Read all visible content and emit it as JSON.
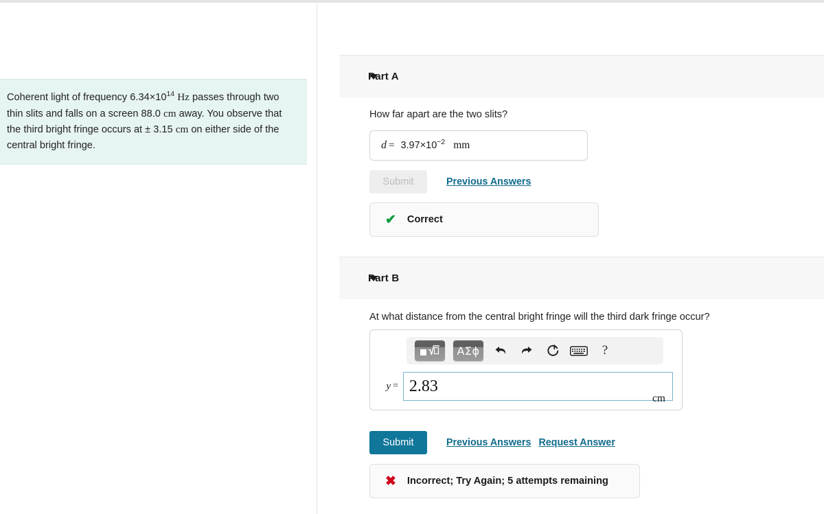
{
  "problem": {
    "text_lines": [
      "Coherent light of frequency 6.34×10",
      " passes through two thin slits and falls on a screen 88.0 ",
      " away. You observe that the third bright fringe occurs at ± 3.15 ",
      " on either side of the central bright fringe."
    ],
    "frequency_mantissa": "6.34×10",
    "frequency_exponent": "14",
    "frequency_unit": "Hz",
    "screen_distance": "88.0",
    "screen_distance_unit": "cm",
    "fringe_position": "± 3.15",
    "fringe_position_unit": "cm",
    "seg1": "Coherent light of frequency 6.34×10",
    "seg2": " passes through two thin slits and falls on a screen 88.0 ",
    "seg3": " away. You observe that the third bright fringe occurs at ± 3.15 ",
    "seg4": " on either side of the central bright fringe."
  },
  "part_a": {
    "title": "Part A",
    "caret_icon": "caret-down-icon",
    "question": "How far apart are the two slits?",
    "answer": {
      "variable": "d",
      "equals": "=",
      "mantissa": "3.97×10",
      "exponent": "−2",
      "unit": "mm"
    },
    "submit_label": "Submit",
    "submit_enabled": false,
    "previous_answers_label": "Previous Answers",
    "feedback": {
      "icon": "check-icon",
      "glyph": "✔",
      "text": "Correct",
      "color": "#0b9a3c"
    }
  },
  "part_b": {
    "title": "Part B",
    "caret_icon": "caret-down-icon",
    "question": "At what distance from the central bright fringe will the third dark fringe occur?",
    "toolbar": {
      "template_button_label": "math-template-icon",
      "symbols_button_label": "ΑΣϕ",
      "undo_icon": "undo-arrow-icon",
      "redo_icon": "redo-arrow-icon",
      "reset_icon": "reset-circular-arrow-icon",
      "keyboard_icon": "keyboard-icon",
      "help_icon": "question-mark-icon",
      "help_label": "?"
    },
    "input": {
      "variable": "y",
      "equals": "=",
      "value": "2.83",
      "placeholder": "",
      "unit": "cm"
    },
    "submit_label": "Submit",
    "submit_enabled": true,
    "previous_answers_label": "Previous Answers",
    "request_answer_label": "Request Answer",
    "feedback": {
      "icon": "cross-icon",
      "glyph": "✖",
      "text": "Incorrect; Try Again; 5 attempts remaining",
      "color": "#d0021b"
    }
  },
  "colors": {
    "accent": "#10769a",
    "link": "#116b8c",
    "correct": "#0b9a3c",
    "incorrect": "#d0021b",
    "problem_bg": "#e6f4f2",
    "header_bg": "#f7f7f7"
  }
}
